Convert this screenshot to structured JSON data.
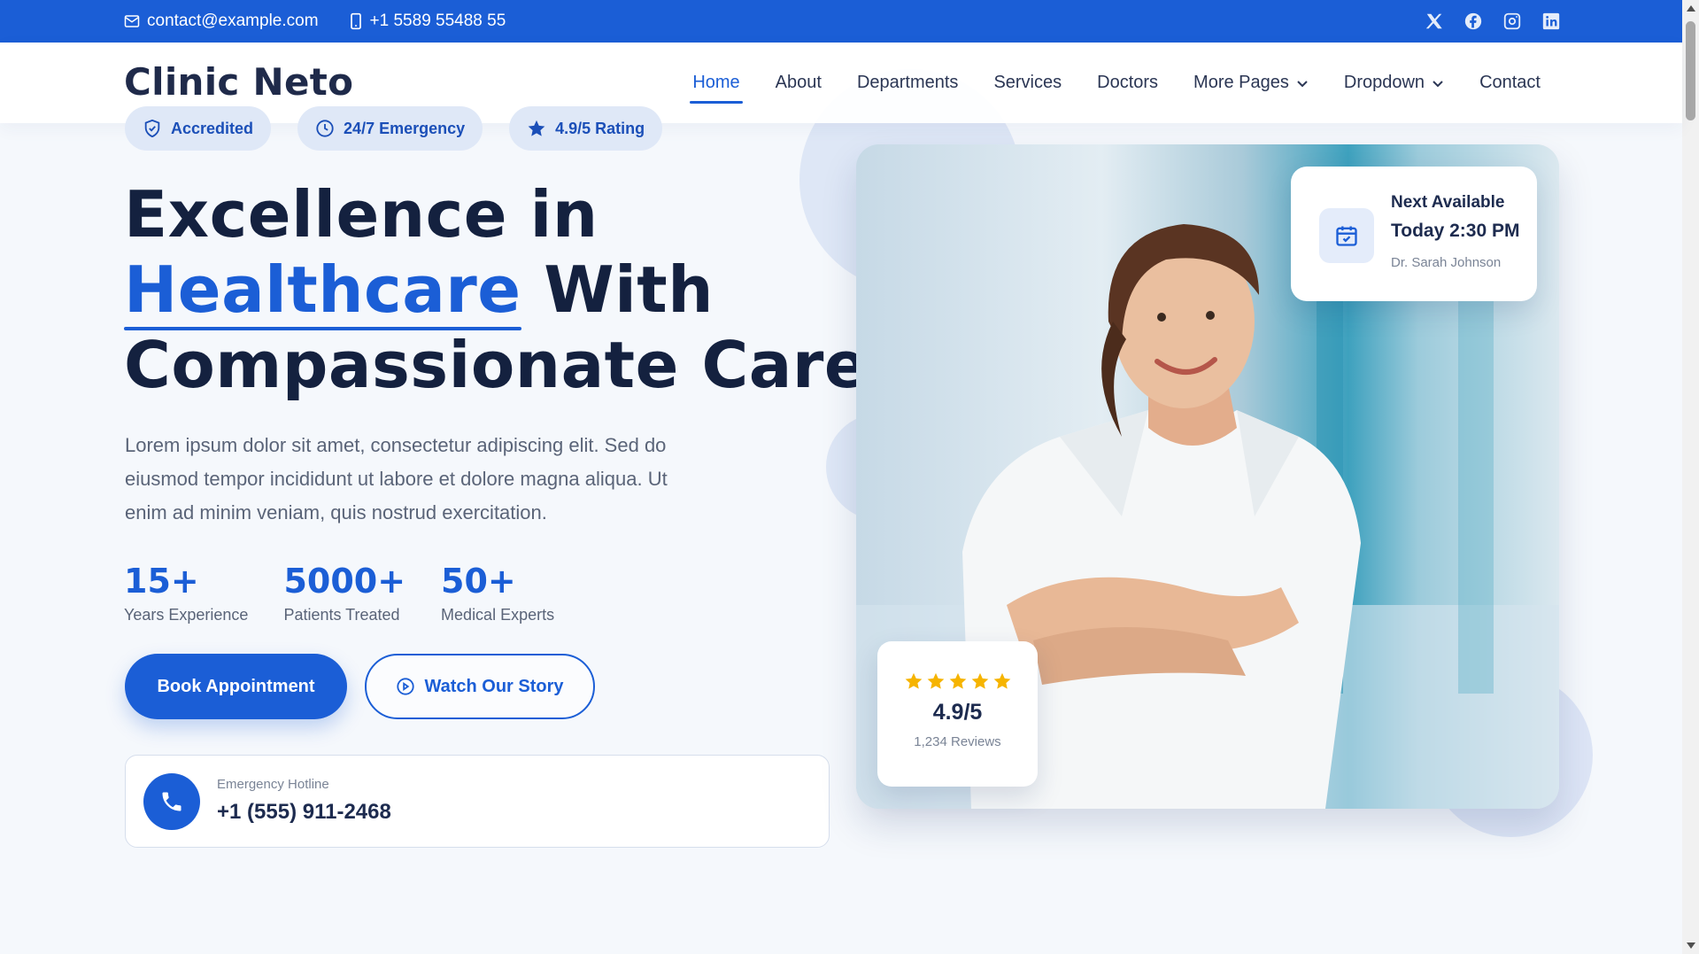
{
  "topbar": {
    "email": "contact@example.com",
    "phone": "+1 5589 55488 55",
    "social": [
      "x-icon",
      "facebook-icon",
      "instagram-icon",
      "linkedin-icon"
    ]
  },
  "header": {
    "logo": "Clinic Neto",
    "nav": [
      {
        "label": "Home",
        "active": true
      },
      {
        "label": "About"
      },
      {
        "label": "Departments"
      },
      {
        "label": "Services"
      },
      {
        "label": "Doctors"
      },
      {
        "label": "More Pages",
        "dropdown": true
      },
      {
        "label": "Dropdown",
        "dropdown": true
      },
      {
        "label": "Contact"
      }
    ]
  },
  "badges": [
    {
      "icon": "shield-check-icon",
      "label": "Accredited"
    },
    {
      "icon": "clock-icon",
      "label": "24/7 Emergency"
    },
    {
      "icon": "star-icon",
      "label": "4.9/5 Rating"
    }
  ],
  "hero": {
    "title_line1": "Excellence in",
    "title_accent": "Healthcare",
    "title_line2_rest": " With",
    "title_line3": "Compassionate Care",
    "text": "Lorem ipsum dolor sit amet, consectetur adipiscing elit. Sed do eiusmod tempor incididunt ut labore et dolore magna aliqua. Ut enim ad minim veniam, quis nostrud exercitation."
  },
  "stats": [
    {
      "value": "15+",
      "label": "Years Experience"
    },
    {
      "value": "5000+",
      "label": "Patients Treated"
    },
    {
      "value": "50+",
      "label": "Medical Experts"
    }
  ],
  "buttons": {
    "primary": "Book Appointment",
    "secondary": "Watch Our Story"
  },
  "hotline": {
    "label": "Emergency Hotline",
    "number": "+1 (555) 911-2468"
  },
  "next_available": {
    "title": "Next Available",
    "time": "Today 2:30 PM",
    "doctor": "Dr. Sarah Johnson"
  },
  "rating_card": {
    "stars": 5,
    "score": "4.9/5",
    "reviews": "1,234 Reviews"
  },
  "colors": {
    "primary": "#1b5ed6",
    "heading": "#14213f",
    "star": "#f6b400"
  }
}
